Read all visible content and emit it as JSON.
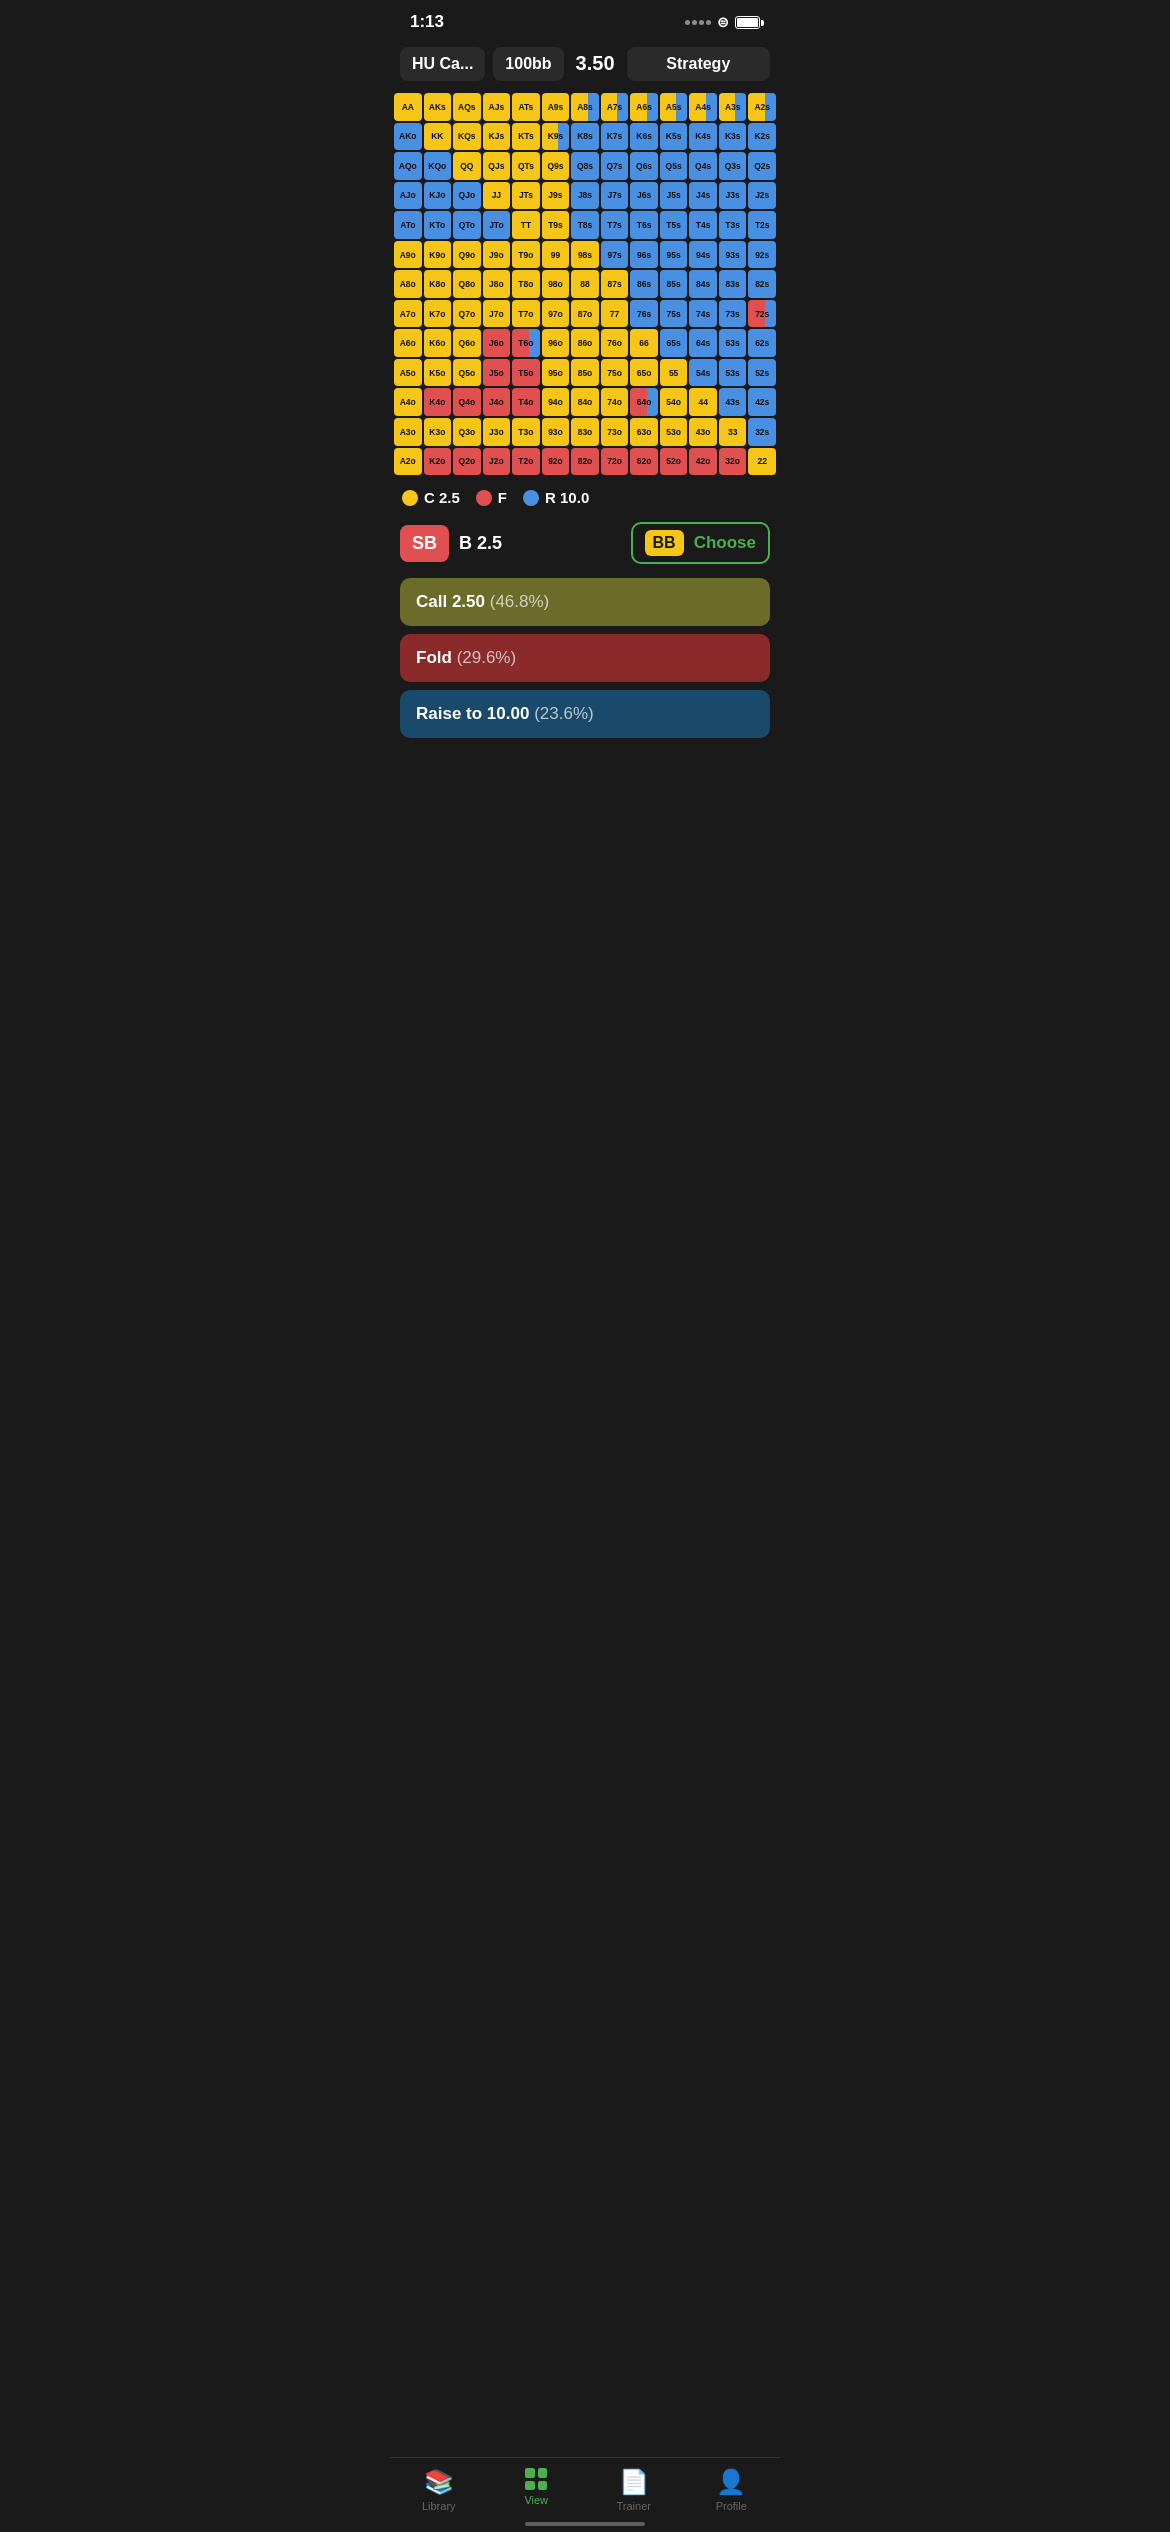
{
  "statusBar": {
    "time": "1:13"
  },
  "header": {
    "position": "HU Ca...",
    "stack": "100bb",
    "raise": "3.50",
    "mode": "Strategy"
  },
  "legend": {
    "call": "C 2.5",
    "fold": "F",
    "raise": "R 10.0"
  },
  "positions": {
    "sb": "SB",
    "sbBet": "B 2.5",
    "bb": "BB",
    "bbAction": "Choose"
  },
  "actions": {
    "call": "Call 2.50",
    "callPct": "(46.8%)",
    "fold": "Fold",
    "foldPct": "(29.6%)",
    "raise": "Raise to 10.00",
    "raisePct": "(23.6%)"
  },
  "nav": {
    "library": "Library",
    "view": "View",
    "trainer": "Trainer",
    "profile": "Profile"
  },
  "grid": [
    [
      "AA",
      "AKs",
      "AQs",
      "AJs",
      "ATs",
      "A9s",
      "A8s",
      "A7s",
      "A6s",
      "A5s",
      "A4s",
      "A3s",
      "A2s"
    ],
    [
      "AKo",
      "KK",
      "KQs",
      "KJs",
      "KTs",
      "K9s",
      "K8s",
      "K7s",
      "K6s",
      "K5s",
      "K4s",
      "K3s",
      "K2s"
    ],
    [
      "AQo",
      "KQo",
      "QQ",
      "QJs",
      "QTs",
      "Q9s",
      "Q8s",
      "Q7s",
      "Q6s",
      "Q5s",
      "Q4s",
      "Q3s",
      "Q2s"
    ],
    [
      "AJo",
      "KJo",
      "QJo",
      "JJ",
      "JTs",
      "J9s",
      "J8s",
      "J7s",
      "J6s",
      "J5s",
      "J4s",
      "J3s",
      "J2s"
    ],
    [
      "ATo",
      "KTo",
      "QTo",
      "JTo",
      "TT",
      "T9s",
      "T8s",
      "T7s",
      "T6s",
      "T5s",
      "T4s",
      "T3s",
      "T2s"
    ],
    [
      "A9o",
      "K9o",
      "Q9o",
      "J9o",
      "T9o",
      "99",
      "98s",
      "97s",
      "96s",
      "95s",
      "94s",
      "93s",
      "92s"
    ],
    [
      "A8o",
      "K8o",
      "Q8o",
      "J8o",
      "T8o",
      "98o",
      "88",
      "87s",
      "86s",
      "85s",
      "84s",
      "83s",
      "82s"
    ],
    [
      "A7o",
      "K7o",
      "Q7o",
      "J7o",
      "T7o",
      "97o",
      "87o",
      "77",
      "76s",
      "75s",
      "74s",
      "73s",
      "72s"
    ],
    [
      "A6o",
      "K6o",
      "Q6o",
      "J6o",
      "T6o",
      "96o",
      "86o",
      "76o",
      "66",
      "65s",
      "64s",
      "63s",
      "62s"
    ],
    [
      "A5o",
      "K5o",
      "Q5o",
      "J5o",
      "T5o",
      "95o",
      "85o",
      "75o",
      "65o",
      "55",
      "54s",
      "53s",
      "52s"
    ],
    [
      "A4o",
      "K4o",
      "Q4o",
      "J4o",
      "T4o",
      "94o",
      "84o",
      "74o",
      "64o",
      "54o",
      "44",
      "43s",
      "42s"
    ],
    [
      "A3o",
      "K3o",
      "Q3o",
      "J3o",
      "T3o",
      "93o",
      "83o",
      "73o",
      "63o",
      "53o",
      "43o",
      "33",
      "32s"
    ],
    [
      "A2o",
      "K2o",
      "Q2o",
      "J2o",
      "T2o",
      "92o",
      "82o",
      "72o",
      "62o",
      "52o",
      "42o",
      "32o",
      "22"
    ]
  ],
  "gridColors": [
    [
      "yellow",
      "yellow",
      "yellow",
      "yellow",
      "yellow",
      "yellow",
      "mixed-yb",
      "mixed-yb",
      "mixed-yb",
      "mixed-yb",
      "mixed-yb",
      "mixed-yb",
      "mixed-yb"
    ],
    [
      "blue",
      "yellow",
      "yellow",
      "yellow",
      "yellow",
      "mixed-yb",
      "blue",
      "blue",
      "blue",
      "blue",
      "blue",
      "blue",
      "blue"
    ],
    [
      "blue",
      "blue",
      "yellow",
      "yellow",
      "yellow",
      "yellow",
      "blue",
      "blue",
      "blue",
      "blue",
      "blue",
      "blue",
      "blue"
    ],
    [
      "blue",
      "blue",
      "blue",
      "yellow",
      "yellow",
      "yellow",
      "blue",
      "blue",
      "blue",
      "blue",
      "blue",
      "blue",
      "blue"
    ],
    [
      "blue",
      "blue",
      "blue",
      "blue",
      "yellow",
      "yellow",
      "blue",
      "blue",
      "blue",
      "blue",
      "blue",
      "blue",
      "blue"
    ],
    [
      "yellow",
      "yellow",
      "yellow",
      "yellow",
      "yellow",
      "yellow",
      "yellow",
      "blue",
      "blue",
      "blue",
      "blue",
      "blue",
      "blue"
    ],
    [
      "yellow",
      "yellow",
      "yellow",
      "yellow",
      "yellow",
      "yellow",
      "yellow",
      "yellow",
      "blue",
      "blue",
      "blue",
      "blue",
      "blue"
    ],
    [
      "yellow",
      "yellow",
      "yellow",
      "yellow",
      "yellow",
      "yellow",
      "yellow",
      "yellow",
      "blue",
      "blue",
      "blue",
      "blue",
      "mixed-rb"
    ],
    [
      "yellow",
      "yellow",
      "yellow",
      "red",
      "mixed-rb",
      "yellow",
      "yellow",
      "yellow",
      "yellow",
      "blue",
      "blue",
      "blue",
      "blue"
    ],
    [
      "yellow",
      "yellow",
      "yellow",
      "red",
      "red",
      "yellow",
      "yellow",
      "yellow",
      "yellow",
      "yellow",
      "blue",
      "blue",
      "blue"
    ],
    [
      "yellow",
      "red",
      "red",
      "red",
      "red",
      "yellow",
      "yellow",
      "yellow",
      "mixed-rb",
      "yellow",
      "yellow",
      "blue",
      "blue"
    ],
    [
      "yellow",
      "yellow",
      "yellow",
      "yellow",
      "yellow",
      "yellow",
      "yellow",
      "yellow",
      "yellow",
      "yellow",
      "yellow",
      "yellow",
      "blue"
    ],
    [
      "yellow",
      "red",
      "red",
      "red",
      "red",
      "red",
      "red",
      "red",
      "red",
      "red",
      "red",
      "red",
      "yellow"
    ]
  ]
}
